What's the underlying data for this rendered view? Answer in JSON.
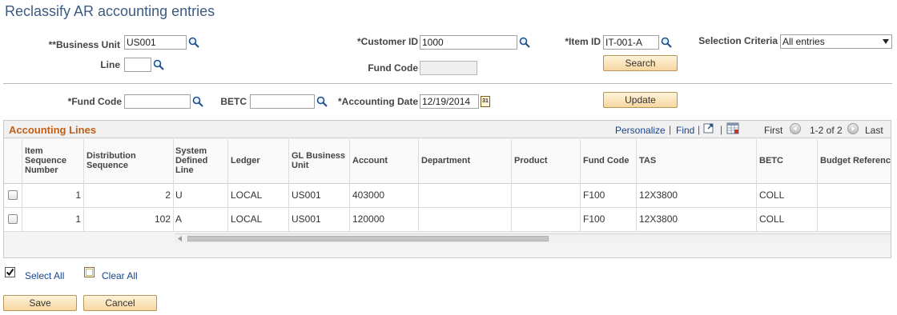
{
  "page": {
    "title": "Reclassify AR accounting entries"
  },
  "criteria": {
    "business_unit_label": "**Business Unit",
    "business_unit_value": "US001",
    "customer_id_label": "*Customer ID",
    "customer_id_value": "1000",
    "item_id_label": "*Item ID",
    "item_id_value": "IT-001-A",
    "selection_criteria_label": "Selection Criteria",
    "selection_criteria_value": "All entries",
    "line_label": "Line",
    "line_value": "",
    "fund_code_label": "Fund Code",
    "fund_code_value": "",
    "search_label": "Search"
  },
  "update_section": {
    "fund_code_label": "*Fund Code",
    "fund_code_value": "",
    "betc_label": "BETC",
    "betc_value": "",
    "accounting_date_label": "*Accounting Date",
    "accounting_date_value": "12/19/2014",
    "calendar_day": "31",
    "update_label": "Update"
  },
  "grid": {
    "title": "Accounting Lines",
    "personalize": "Personalize",
    "find": "Find",
    "sep": "|",
    "first": "First",
    "range": "1-2 of 2",
    "last": "Last",
    "columns": {
      "item_seq": [
        "Item",
        "Sequence",
        "Number"
      ],
      "dist_seq": [
        "Distribution",
        "Sequence"
      ],
      "system_defined": [
        "System",
        "Defined",
        "Line"
      ],
      "ledger": "Ledger",
      "gl_bu": [
        "GL Business",
        "Unit"
      ],
      "account": "Account",
      "department": "Department",
      "product": "Product",
      "fund_code": "Fund Code",
      "tas": "TAS",
      "betc": "BETC",
      "budget_ref": "Budget Reference"
    },
    "rows": [
      {
        "item_seq": "1",
        "dist_seq": "2",
        "system_defined": "U",
        "ledger": "LOCAL",
        "gl_bu": "US001",
        "account": "403000",
        "department": "",
        "product": "",
        "fund_code": "F100",
        "tas": "12X3800",
        "betc": "COLL",
        "budget_ref": ""
      },
      {
        "item_seq": "1",
        "dist_seq": "102",
        "system_defined": "A",
        "ledger": "LOCAL",
        "gl_bu": "US001",
        "account": "120000",
        "department": "",
        "product": "",
        "fund_code": "F100",
        "tas": "12X3800",
        "betc": "COLL",
        "budget_ref": ""
      }
    ]
  },
  "actions": {
    "select_all": "Select All",
    "clear_all": "Clear All",
    "save": "Save",
    "cancel": "Cancel"
  },
  "colors": {
    "title": "#3d5a80",
    "grid_title": "#c06018",
    "link": "#16458f",
    "button": "#f6d7a0"
  },
  "icons": [
    "lookup-icon",
    "calendar-icon",
    "dropdown-arrow-icon",
    "zoom-icon",
    "download-icon",
    "prev-icon",
    "next-icon",
    "checkbox-checked-icon",
    "checkbox-empty-icon"
  ]
}
